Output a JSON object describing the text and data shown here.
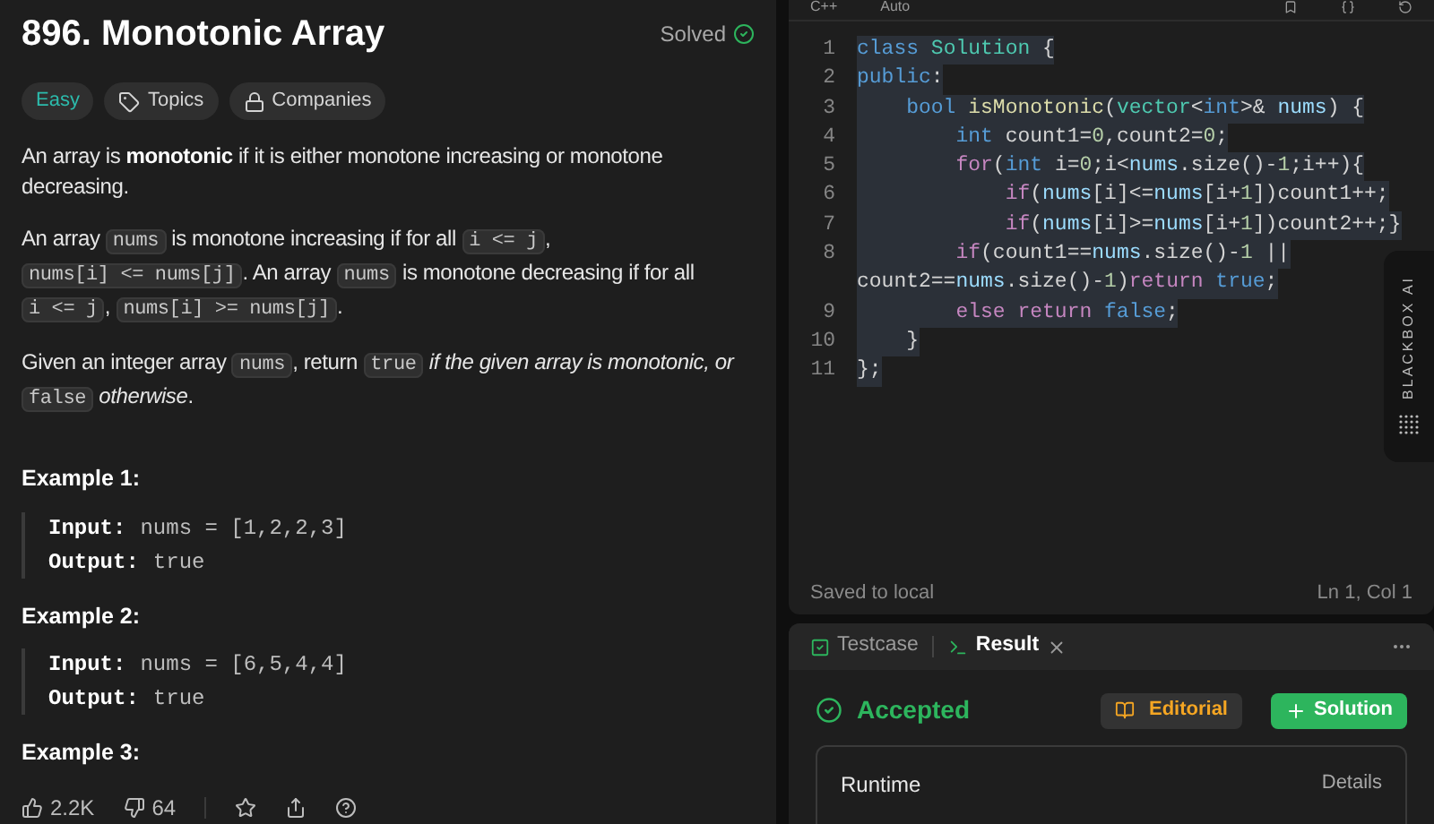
{
  "problem": {
    "title": "896. Monotonic Array",
    "status": "Solved",
    "tags": [
      {
        "kind": "difficulty",
        "label": "Easy"
      },
      {
        "kind": "topics",
        "label": "Topics"
      },
      {
        "kind": "companies",
        "label": "Companies"
      }
    ],
    "paragraphs": [
      [
        {
          "kind": "text",
          "text": "An array is **monotonic** if it is either monotone increasing or monotone decreasing."
        }
      ],
      [
        {
          "kind": "text",
          "text": "An array "
        },
        {
          "kind": "code",
          "text": "nums"
        },
        {
          "kind": "text",
          "text": " is monotone increasing if for all "
        },
        {
          "kind": "code",
          "text": "i <= j"
        },
        {
          "kind": "text",
          "text": ", "
        },
        {
          "kind": "code",
          "text": "nums[i] <= nums[j]"
        },
        {
          "kind": "text",
          "text": ". An array "
        },
        {
          "kind": "code",
          "text": "nums"
        },
        {
          "kind": "text",
          "text": " is monotone decreasing if for all "
        },
        {
          "kind": "code",
          "text": "i <= j"
        },
        {
          "kind": "text",
          "text": ", "
        },
        {
          "kind": "code",
          "text": "nums[i] >= nums[j]"
        },
        {
          "kind": "text",
          "text": "."
        }
      ],
      [
        {
          "kind": "text",
          "text": "Given an integer array "
        },
        {
          "kind": "code",
          "text": "nums"
        },
        {
          "kind": "text",
          "text": ", return "
        },
        {
          "kind": "code",
          "text": "true"
        },
        {
          "kind": "italic",
          "text": " if the given array is monotonic, or "
        },
        {
          "kind": "code",
          "text": "false"
        },
        {
          "kind": "italic",
          "text": " otherwise"
        },
        {
          "kind": "text",
          "text": "."
        }
      ]
    ],
    "examples": [
      {
        "title": "Example 1:",
        "lines": [
          {
            "label": "Input:",
            "value": "nums = [1,2,2,3]"
          },
          {
            "label": "Output:",
            "value": "true"
          }
        ]
      },
      {
        "title": "Example 2:",
        "lines": [
          {
            "label": "Input:",
            "value": "nums = [6,5,4,4]"
          },
          {
            "label": "Output:",
            "value": "true"
          }
        ]
      },
      {
        "title": "Example 3:"
      }
    ],
    "footer": {
      "likes": "2.2K",
      "dislikes": "64"
    }
  },
  "editor": {
    "language": "C++",
    "mode": "Auto",
    "lines": [
      {
        "number": "1",
        "selected": true,
        "tokens": [
          {
            "kind": "keyword",
            "text": "class"
          },
          {
            "kind": "type",
            "text": " Solution"
          },
          {
            "kind": "plain",
            "text": " {"
          }
        ]
      },
      {
        "number": "2",
        "selected": true,
        "tokens": [
          {
            "kind": "keyword",
            "text": "public"
          },
          {
            "kind": "plain",
            "text": ":"
          }
        ]
      },
      {
        "number": "3",
        "selected": true,
        "tokens": [
          {
            "kind": "keyword",
            "text": "    bool"
          },
          {
            "kind": "func",
            "text": " isMonotonic"
          },
          {
            "kind": "plain",
            "text": "("
          },
          {
            "kind": "type",
            "text": "vector"
          },
          {
            "kind": "plain",
            "text": "<"
          },
          {
            "kind": "keyword",
            "text": "int"
          },
          {
            "kind": "plain",
            "text": ">& "
          },
          {
            "kind": "var",
            "text": "nums"
          },
          {
            "kind": "plain",
            "text": ") {"
          }
        ]
      },
      {
        "number": "4",
        "selected": true,
        "tokens": [
          {
            "kind": "keyword",
            "text": "        int"
          },
          {
            "kind": "plain",
            "text": " count1="
          },
          {
            "kind": "num",
            "text": "0"
          },
          {
            "kind": "plain",
            "text": ",count2="
          },
          {
            "kind": "num",
            "text": "0"
          },
          {
            "kind": "plain",
            "text": ";"
          }
        ]
      },
      {
        "number": "5",
        "selected": true,
        "tokens": [
          {
            "kind": "control",
            "text": "        for"
          },
          {
            "kind": "plain",
            "text": "("
          },
          {
            "kind": "keyword",
            "text": "int"
          },
          {
            "kind": "plain",
            "text": " i="
          },
          {
            "kind": "num",
            "text": "0"
          },
          {
            "kind": "plain",
            "text": ";i<"
          },
          {
            "kind": "var",
            "text": "nums"
          },
          {
            "kind": "plain",
            "text": ".size()-"
          },
          {
            "kind": "num",
            "text": "1"
          },
          {
            "kind": "plain",
            "text": ";i++){"
          }
        ]
      },
      {
        "number": "6",
        "selected": true,
        "tokens": [
          {
            "kind": "control",
            "text": "            if"
          },
          {
            "kind": "plain",
            "text": "("
          },
          {
            "kind": "var",
            "text": "nums"
          },
          {
            "kind": "plain",
            "text": "[i]<="
          },
          {
            "kind": "var",
            "text": "nums"
          },
          {
            "kind": "plain",
            "text": "[i+"
          },
          {
            "kind": "num",
            "text": "1"
          },
          {
            "kind": "plain",
            "text": "])count1++;"
          }
        ]
      },
      {
        "number": "7",
        "selected": true,
        "tokens": [
          {
            "kind": "control",
            "text": "            if"
          },
          {
            "kind": "plain",
            "text": "("
          },
          {
            "kind": "var",
            "text": "nums"
          },
          {
            "kind": "plain",
            "text": "[i]>="
          },
          {
            "kind": "var",
            "text": "nums"
          },
          {
            "kind": "plain",
            "text": "[i+"
          },
          {
            "kind": "num",
            "text": "1"
          },
          {
            "kind": "plain",
            "text": "])count2++;}"
          }
        ]
      },
      {
        "number": "8",
        "selected": true,
        "tokens": [
          {
            "kind": "control",
            "text": "        if"
          },
          {
            "kind": "plain",
            "text": "(count1=="
          },
          {
            "kind": "var",
            "text": "nums"
          },
          {
            "kind": "plain",
            "text": ".size()-"
          },
          {
            "kind": "num",
            "text": "1"
          },
          {
            "kind": "plain",
            "text": " ||"
          }
        ]
      },
      {
        "selected": true,
        "tokens": [
          {
            "kind": "plain",
            "text": "count2=="
          },
          {
            "kind": "var",
            "text": "nums"
          },
          {
            "kind": "plain",
            "text": ".size()-"
          },
          {
            "kind": "num",
            "text": "1"
          },
          {
            "kind": "plain",
            "text": ")"
          },
          {
            "kind": "control",
            "text": "return"
          },
          {
            "kind": "keyword",
            "text": " true"
          },
          {
            "kind": "plain",
            "text": ";"
          }
        ]
      },
      {
        "number": "9",
        "selected": true,
        "tokens": [
          {
            "kind": "control",
            "text": "        else return"
          },
          {
            "kind": "keyword",
            "text": " false"
          },
          {
            "kind": "plain",
            "text": ";"
          }
        ]
      },
      {
        "number": "10",
        "selected": true,
        "tokens": [
          {
            "kind": "plain",
            "text": "    }"
          }
        ]
      },
      {
        "number": "11",
        "selected": true,
        "tokens": [
          {
            "kind": "plain",
            "text": "};"
          }
        ]
      }
    ],
    "side_tab": "BLACKBOX AI",
    "status_left": "Saved to local",
    "status_right": "Ln 1, Col 1"
  },
  "result": {
    "tabs": [
      {
        "kind": "testcase",
        "label": "Testcase",
        "selected": false
      },
      {
        "kind": "result",
        "label": "Result",
        "selected": true
      }
    ],
    "verdict": "Accepted",
    "editorial": "Editorial",
    "solution": "Solution",
    "card": {
      "label": "Runtime",
      "link": "Details"
    }
  }
}
